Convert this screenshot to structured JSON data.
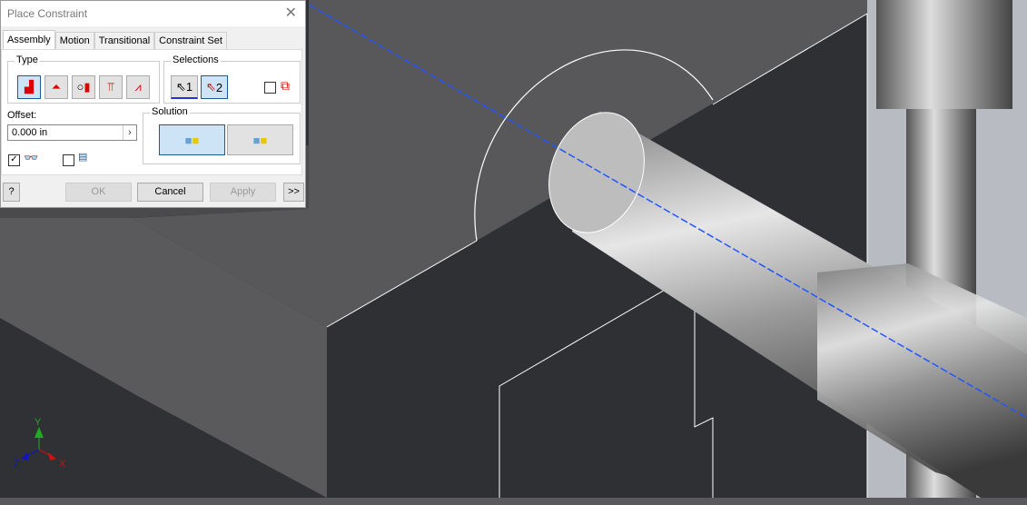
{
  "dialog": {
    "title": "Place Constraint",
    "tabs": [
      "Assembly",
      "Motion",
      "Transitional",
      "Constraint Set"
    ],
    "type_label": "Type",
    "type_buttons": [
      "mate",
      "angle",
      "tangent",
      "insert",
      "symmetry"
    ],
    "selections_label": "Selections",
    "sel1": "1",
    "sel2": "2",
    "offset_label": "Offset:",
    "offset_value": "0.000 in",
    "solution_label": "Solution",
    "show_preview_checked": true,
    "predict_offset_checked": false,
    "pick_part_first_checked": false,
    "ok": "OK",
    "cancel": "Cancel",
    "apply": "Apply",
    "more": ">>",
    "help": "?"
  },
  "axes": {
    "x": "X",
    "y": "Y",
    "z": "Z"
  },
  "colors": {
    "accent": "#1a5a9a",
    "axis_x": "#cc1111",
    "axis_y": "#22aa22",
    "axis_z": "#1111cc",
    "centerline": "#2255ff"
  }
}
